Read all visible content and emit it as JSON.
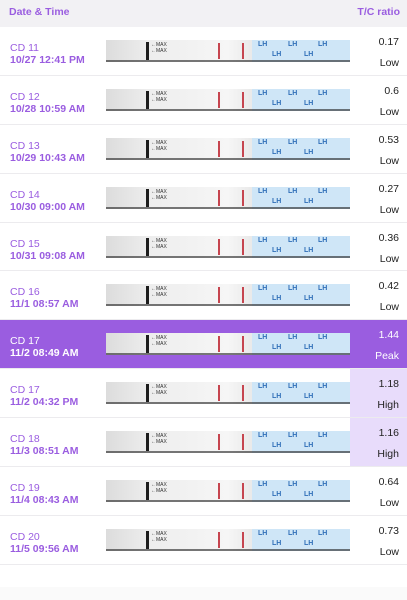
{
  "header": {
    "left": "Date & Time",
    "right": "T/C ratio"
  },
  "rows": [
    {
      "cd": "CD 11",
      "datetime": "10/27  12:41 PM",
      "ratio": "0.17",
      "level": "Low",
      "state": "normal"
    },
    {
      "cd": "CD 12",
      "datetime": "10/28  10:59 AM",
      "ratio": "0.6",
      "level": "Low",
      "state": "normal"
    },
    {
      "cd": "CD 13",
      "datetime": "10/29  10:43 AM",
      "ratio": "0.53",
      "level": "Low",
      "state": "normal"
    },
    {
      "cd": "CD 14",
      "datetime": "10/30  09:00 AM",
      "ratio": "0.27",
      "level": "Low",
      "state": "normal"
    },
    {
      "cd": "CD 15",
      "datetime": "10/31  09:08 AM",
      "ratio": "0.36",
      "level": "Low",
      "state": "normal"
    },
    {
      "cd": "CD 16",
      "datetime": "11/1  08:57 AM",
      "ratio": "0.42",
      "level": "Low",
      "state": "normal"
    },
    {
      "cd": "CD 17",
      "datetime": "11/2  08:49 AM",
      "ratio": "1.44",
      "level": "Peak",
      "state": "peak"
    },
    {
      "cd": "CD 17",
      "datetime": "11/2  04:32 PM",
      "ratio": "1.18",
      "level": "High",
      "state": "high"
    },
    {
      "cd": "CD 18",
      "datetime": "11/3  08:51 AM",
      "ratio": "1.16",
      "level": "High",
      "state": "high"
    },
    {
      "cd": "CD 19",
      "datetime": "11/4  08:43 AM",
      "ratio": "0.64",
      "level": "Low",
      "state": "normal"
    },
    {
      "cd": "CD 20",
      "datetime": "11/5  09:56 AM",
      "ratio": "0.73",
      "level": "Low",
      "state": "normal"
    }
  ],
  "strip_labels": {
    "max": "MAX",
    "lh": "LH"
  },
  "colors": {
    "accent": "#9a5de0",
    "high_bg": "#e8dcfb",
    "header_bg": "#f2f1f4"
  }
}
